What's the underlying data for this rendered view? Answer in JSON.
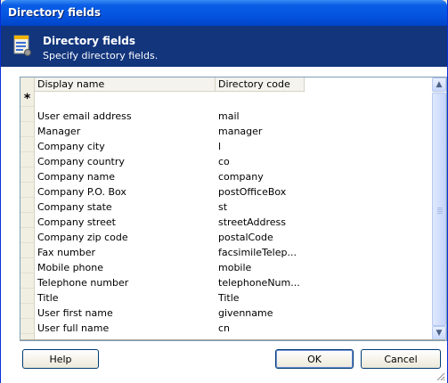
{
  "window": {
    "title": "Directory fields"
  },
  "header": {
    "title": "Directory fields",
    "subtitle": "Specify directory fields.",
    "icon": "form-icon"
  },
  "grid": {
    "columns": [
      "Display name",
      "Directory code"
    ],
    "new_row_marker": "*",
    "rows": [
      {
        "display": "User email address",
        "code": "mail"
      },
      {
        "display": "Manager",
        "code": "manager"
      },
      {
        "display": "Company city",
        "code": "l"
      },
      {
        "display": "Company country",
        "code": "co"
      },
      {
        "display": "Company name",
        "code": "company"
      },
      {
        "display": "Company P.O. Box",
        "code": "postOfficeBox"
      },
      {
        "display": "Company state",
        "code": "st"
      },
      {
        "display": "Company street",
        "code": "streetAddress"
      },
      {
        "display": "Company zip code",
        "code": "postalCode"
      },
      {
        "display": "Fax number",
        "code": "facsimileTelep..."
      },
      {
        "display": "Mobile phone",
        "code": "mobile"
      },
      {
        "display": "Telephone number",
        "code": "telephoneNum..."
      },
      {
        "display": "Title",
        "code": "Title"
      },
      {
        "display": "User first name",
        "code": "givenname"
      },
      {
        "display": "User full name",
        "code": "cn"
      }
    ]
  },
  "buttons": {
    "help": "Help",
    "ok": "OK",
    "cancel": "Cancel"
  }
}
